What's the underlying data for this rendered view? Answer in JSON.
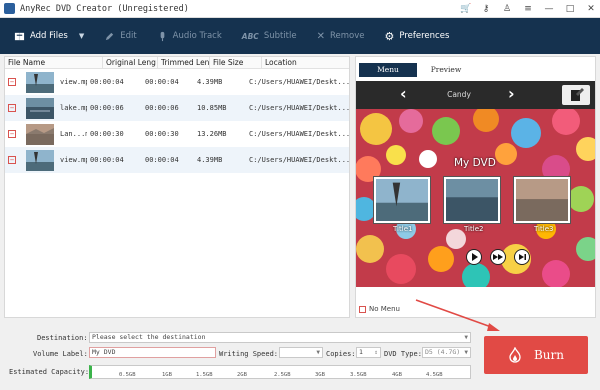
{
  "app": {
    "title": "AnyRec DVD Creator (Unregistered)"
  },
  "window_controls": [
    "cart-icon",
    "key-icon",
    "user-icon",
    "menu-icon",
    "minimize-icon",
    "maximize-icon",
    "close-icon"
  ],
  "toolbar": {
    "add_files": "Add Files",
    "edit": "Edit",
    "audio_track": "Audio Track",
    "subtitle_prefix": "ABC",
    "subtitle": "Subtitle",
    "remove": "Remove",
    "preferences": "Preferences"
  },
  "file_list": {
    "columns": [
      "File Name",
      "Original Leng",
      "Trimmed Len",
      "File Size",
      "Location"
    ],
    "rows": [
      {
        "name": "view.mp4",
        "original": "00:00:04",
        "trimmed": "00:00:04",
        "size": "4.39MB",
        "location": "C:/Users/HUAWEI/Deskt..."
      },
      {
        "name": "lake.mp4",
        "original": "00:00:06",
        "trimmed": "00:00:06",
        "size": "10.85MB",
        "location": "C:/Users/HUAWEI/Deskt..."
      },
      {
        "name": "Lan...mp4",
        "original": "00:00:30",
        "trimmed": "00:00:30",
        "size": "13.26MB",
        "location": "C:/Users/HUAWEI/Deskt..."
      },
      {
        "name": "view.mp4",
        "original": "00:00:04",
        "trimmed": "00:00:04",
        "size": "4.39MB",
        "location": "C:/Users/HUAWEI/Deskt..."
      }
    ]
  },
  "preview": {
    "tabs": [
      "Menu",
      "Preview"
    ],
    "active_tab": "Menu",
    "template_name": "Candy",
    "menu_title": "My DVD",
    "chapters": [
      "Title1",
      "Title2",
      "Title3"
    ],
    "no_menu_label": "No Menu"
  },
  "bottom": {
    "destination_label": "Destination:",
    "destination_placeholder": "Please select the destination",
    "volume_label": "Volume Label:",
    "volume_value": "My DVD",
    "writing_speed_label": "Writing Speed:",
    "copies_label": "Copies:",
    "copies_value": "1",
    "dvd_type_label": "DVD Type:",
    "dvd_type_value": "D5 (4.7G)",
    "capacity_label": "Estimated Capacity:",
    "capacity_ticks": [
      "0.5GB",
      "1GB",
      "1.5GB",
      "2GB",
      "2.5GB",
      "3GB",
      "3.5GB",
      "4GB",
      "4.5GB"
    ]
  },
  "burn": {
    "label": "Burn"
  },
  "colors": {
    "toolbar_bg": "#15324f",
    "burn_bg": "#e14a45",
    "accent_red": "#d9534f",
    "capacity_fill": "#3bb34a"
  }
}
